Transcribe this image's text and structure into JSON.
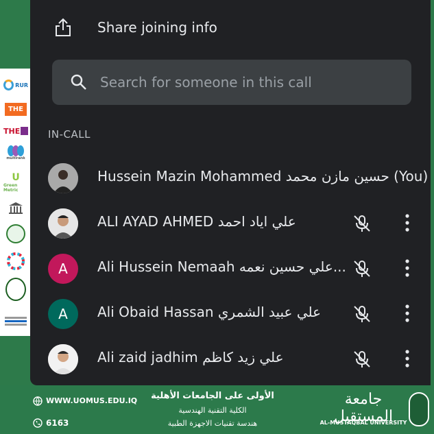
{
  "share": {
    "label": "Share joining info",
    "icon": "share-icon"
  },
  "search": {
    "placeholder": "Search for someone in this call"
  },
  "section": {
    "label": "IN-CALL"
  },
  "participants": [
    {
      "name": "Hussein Mazin Mohammed حسين مازن محمد (You)",
      "avatar": "photo",
      "muted": false,
      "more": false
    },
    {
      "name": "ALI AYAD AHMED علي اياد احمد",
      "avatar": "photo",
      "muted": true,
      "more": true
    },
    {
      "name": "Ali Hussein Nemaah علي حسين نعمه...",
      "avatar_letter": "A",
      "avatar_color": "#c2185b",
      "muted": true,
      "more": true
    },
    {
      "name": "Ali Obaid Hassan علي عبيد الشمري",
      "avatar_letter": "A",
      "avatar_color": "#00695c",
      "muted": true,
      "more": true
    },
    {
      "name": "Ali zaid jadhim علي زيد كاظم",
      "avatar": "photo",
      "muted": true,
      "more": true
    }
  ],
  "left_logos": [
    "RUR",
    "THE",
    "THE",
    "multirank",
    "Green Metric"
  ],
  "footer": {
    "website": "WWW.UOMUS.EDU.IQ",
    "phone": "6163",
    "line1": "الأولى على الجامعات الأهلية",
    "line2": "الكلية التقنية الهندسية",
    "line3": "هندسة تقنيات الاجهزة الطبية",
    "uni_ar": "جامعة المستقبل",
    "uni_en": "AL-MUSTAQBAL UNIVERSITY"
  },
  "colors": {
    "panel": "#202124",
    "green": "#2c7a4b",
    "text": "#e8eaed"
  }
}
